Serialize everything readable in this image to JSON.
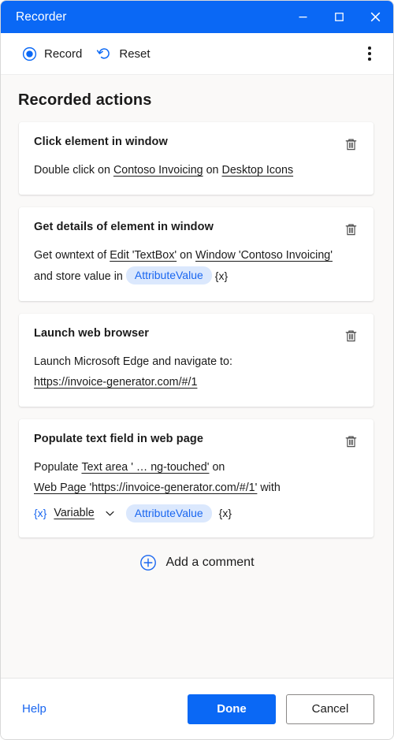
{
  "window": {
    "title": "Recorder",
    "minimize_label": "Minimize",
    "maximize_label": "Maximize",
    "close_label": "Close"
  },
  "toolbar": {
    "record_label": "Record",
    "reset_label": "Reset",
    "more_label": "More options"
  },
  "main": {
    "heading": "Recorded actions",
    "add_comment_label": "Add a comment"
  },
  "cards": [
    {
      "title": "Click element in window",
      "line1_prefix": "Double click on",
      "target1": "Contoso Invoicing",
      "mid1": "on",
      "target2": "Desktop Icons"
    },
    {
      "title": "Get details of element in window",
      "line1_prefix": "Get owntext of",
      "target1": "Edit 'TextBox'",
      "mid1": "on",
      "target2": "Window 'Contoso Invoicing'",
      "line2_prefix": "and store value in",
      "pill": "AttributeValue",
      "var_token": "{x}"
    },
    {
      "title": "Launch web browser",
      "line1": "Launch Microsoft Edge and navigate to:",
      "url": "https://invoice-generator.com/#/1"
    },
    {
      "title": "Populate text field in web page",
      "line1_prefix": "Populate",
      "target1": "Text area ' …  ng-touched'",
      "mid1": "on",
      "target2": "Web Page 'https://invoice-generator.com/#/1'",
      "mid2": "with",
      "var_token_blue": "{x}",
      "dropdown_value": "Variable",
      "pill": "AttributeValue",
      "var_token": "{x}"
    }
  ],
  "footer": {
    "help_label": "Help",
    "done_label": "Done",
    "cancel_label": "Cancel"
  },
  "colors": {
    "accent": "#0a68f5",
    "link": "#1966f0",
    "pill_bg": "#dbe8fd",
    "page_bg": "#faf9f8",
    "card_bg": "#ffffff",
    "text": "#1b1b1b"
  }
}
